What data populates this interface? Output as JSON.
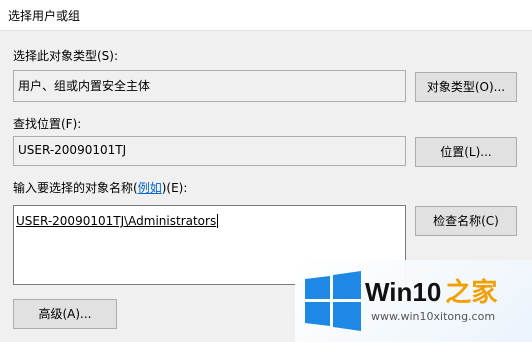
{
  "window": {
    "title": "选择用户或组"
  },
  "object_type": {
    "label": "选择此对象类型(S):",
    "value": "用户、组或内置安全主体",
    "button_label": "对象类型(O)..."
  },
  "location": {
    "label": "查找位置(F):",
    "value": "USER-20090101TJ",
    "button_label": "位置(L)..."
  },
  "names": {
    "label_prefix": "输入要选择的对象名称(",
    "label_link": "例如",
    "label_suffix": ")(E):",
    "value": "USER-20090101TJ\\Administrators",
    "check_button_label": "检查名称(C)"
  },
  "advanced_button_label": "高级(A)...",
  "watermark": {
    "brand": "Win10",
    "brand_accent": "之家",
    "url": "www.win10xitong.com",
    "colors": {
      "blue": "#1e88e5",
      "accent": "#f0a000"
    }
  }
}
